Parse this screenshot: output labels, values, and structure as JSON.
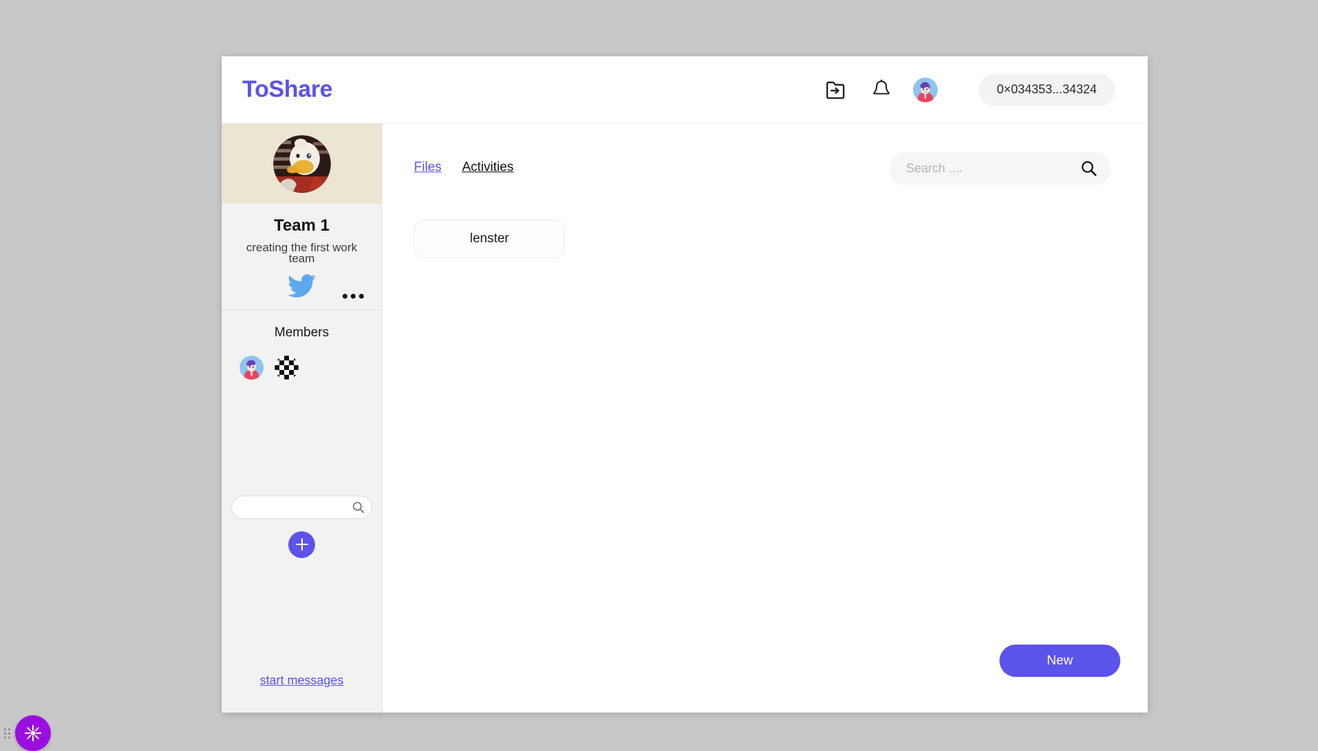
{
  "app": {
    "brand": "ToShare",
    "accent_color": "#5b53ea",
    "banner_color": "#ece5d2",
    "page_background": "#c8c8c8"
  },
  "header": {
    "import_icon": "folder-import-icon",
    "bell_icon": "bell-icon",
    "avatar": "user-avatar",
    "wallet_address": "0×034353...34324"
  },
  "sidebar": {
    "team": {
      "avatar": "duck-team-avatar",
      "name": "Team 1",
      "description": "creating the first work team",
      "social_icon": "twitter-icon",
      "more_menu": "more-options-icon"
    },
    "members": {
      "title": "Members",
      "avatars": [
        "member-avatar-illustrated",
        "member-avatar-checkerboard"
      ]
    },
    "search": {
      "value": "",
      "placeholder": "",
      "icon": "search-icon"
    },
    "add_button": {
      "icon": "plus-icon",
      "color": "#5b53ea"
    },
    "start_messages_link": "start messages"
  },
  "main": {
    "tabs": [
      {
        "label": "Files",
        "active": false
      },
      {
        "label": "Activities",
        "active": true
      }
    ],
    "search": {
      "value": "",
      "placeholder": "Search ....",
      "icon": "search-icon"
    },
    "activities": [
      {
        "label": "lenster"
      }
    ],
    "new_button": "New"
  },
  "floating_widget": {
    "icon": "sun-burst-icon",
    "color": "#9b0ee0",
    "drag_handle": "drag-handle-icon"
  }
}
